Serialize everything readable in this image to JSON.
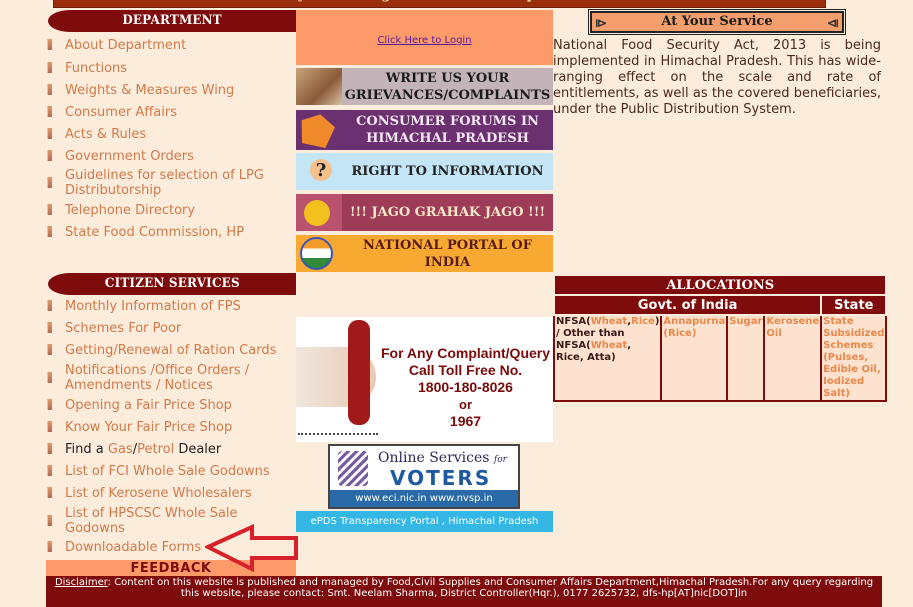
{
  "header": {
    "tagline": "Gateway for Getting Services of the Department"
  },
  "department": {
    "title": "DEPARTMENT",
    "items": [
      {
        "label": "About Department"
      },
      {
        "label": "Functions"
      },
      {
        "label": "Weights & Measures Wing"
      },
      {
        "label": "Consumer Affairs"
      },
      {
        "label": "Acts & Rules"
      },
      {
        "label": "Government Orders"
      },
      {
        "label": "Guidelines for selection of LPG Distributorship"
      },
      {
        "label": "Telephone Directory"
      },
      {
        "label": "State Food Commission, HP"
      }
    ]
  },
  "citizen_services": {
    "title": "CITIZEN SERVICES",
    "items": [
      {
        "label": "Monthly Information of FPS"
      },
      {
        "label": "Schemes For Poor"
      },
      {
        "label": "Getting/Renewal of Ration Cards"
      },
      {
        "label": "Notifications /Office Orders / Amendments / Notices"
      },
      {
        "label": "Opening a Fair Price Shop"
      },
      {
        "label": "Know Your Fair Price Shop"
      },
      {
        "label_prefix": "Find a ",
        "link_gas": "Gas",
        "sep": "/",
        "link_petrol": "Petrol",
        "label_suffix": " Dealer"
      },
      {
        "label": "List of FCI Whole Sale Godowns"
      },
      {
        "label": "List of Kerosene Wholesalers"
      },
      {
        "label": "List of HPSCSC Whole Sale Godowns"
      },
      {
        "label": "Downloadable Forms"
      }
    ]
  },
  "login": {
    "link": "Click Here to Login"
  },
  "banners": {
    "grievances": "WRITE US YOUR GRIEVANCES/COMPLAINTS",
    "consumer_forums": "CONSUMER FORUMS IN HIMACHAL PRADESH",
    "rti": "RIGHT TO INFORMATION",
    "jago": "!!! JAGO GRAHAK JAGO !!!",
    "npi": "NATIONAL PORTAL OF  INDIA"
  },
  "tollfree": {
    "line1": "For Any Complaint/Query",
    "line2": "Call  Toll Free No.",
    "number": "1800-180-8026",
    "or": "or",
    "alt": "1967"
  },
  "voters": {
    "line1": "Online Services",
    "for": "for",
    "line2": "VOTERS",
    "urls": "www.eci.nic.in  www.nvsp.in"
  },
  "epds": "ePDS Transparency Portal , Himachal Pradesh",
  "at_your_service": {
    "title": "At Your Service",
    "text": "National Food Security Act, 2013 is being implemented in Himachal Pradesh. This has wide-ranging effect on the scale and rate of entitlements, as well as the covered beneficiaries, under the Public Distribution System."
  },
  "allocations": {
    "title": "ALLOCATIONS",
    "goi": "Govt. of India",
    "state": "State",
    "cells": {
      "nfsa_a": "NFSA(",
      "wheat": "Wheat",
      "comma": ",",
      "rice": "Rice",
      "nfsa_b": ") / Other than NFSA(",
      "wheat2": "Wheat",
      "nfsa_c": ", Rice, Atta)",
      "annapurna": "Annapurna (Rice)",
      "sugar": "Sugar",
      "kerosene": "Kerosene Oil",
      "state_schemes": " State Subsidized Schemes (Pulses, Edible Oil, Iodized Salt)"
    }
  },
  "feedback": "FEEDBACK",
  "disclaimer": {
    "label": "Disclaimer",
    "text": ": Content on this website is published and managed by Food,Civil Supplies and Consumer Affairs Department,Himachal Pradesh.For any query regarding this website, please contact: Smt. Neelam Sharma, District Controller(Hqr.), 0177 2625732, dfs-hp[AT]nic[DOT]in"
  },
  "colors": {
    "maroon": "#7f0c0c",
    "salmon": "#fd9a69",
    "link_orange": "#d07a4a",
    "bg": "#fcecdc",
    "arrow": "#d8202a"
  }
}
